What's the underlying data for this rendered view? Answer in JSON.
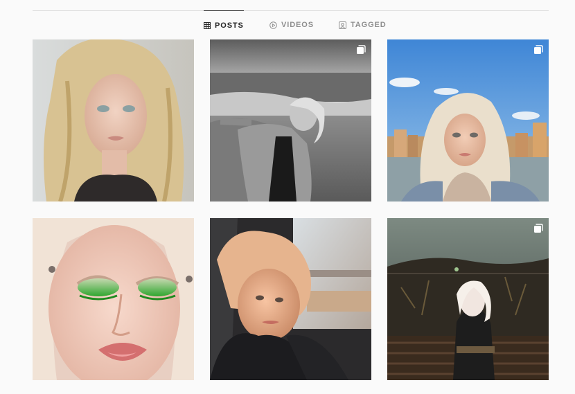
{
  "tabs": [
    {
      "label": "POSTS",
      "icon": "grid-icon",
      "active": true
    },
    {
      "label": "VIDEOS",
      "icon": "play-icon",
      "active": false
    },
    {
      "label": "TAGGED",
      "icon": "tag-portrait-icon",
      "active": false
    }
  ],
  "posts": [
    {
      "kind": "single",
      "multi": false
    },
    {
      "kind": "carousel",
      "multi": true
    },
    {
      "kind": "carousel",
      "multi": true
    },
    {
      "kind": "single",
      "multi": false
    },
    {
      "kind": "single",
      "multi": false
    },
    {
      "kind": "carousel",
      "multi": true
    }
  ],
  "colors": {
    "background": "#fafafa",
    "divider": "#dbdbdb",
    "active_tab": "#262626",
    "inactive_tab": "#8e8e8e"
  }
}
